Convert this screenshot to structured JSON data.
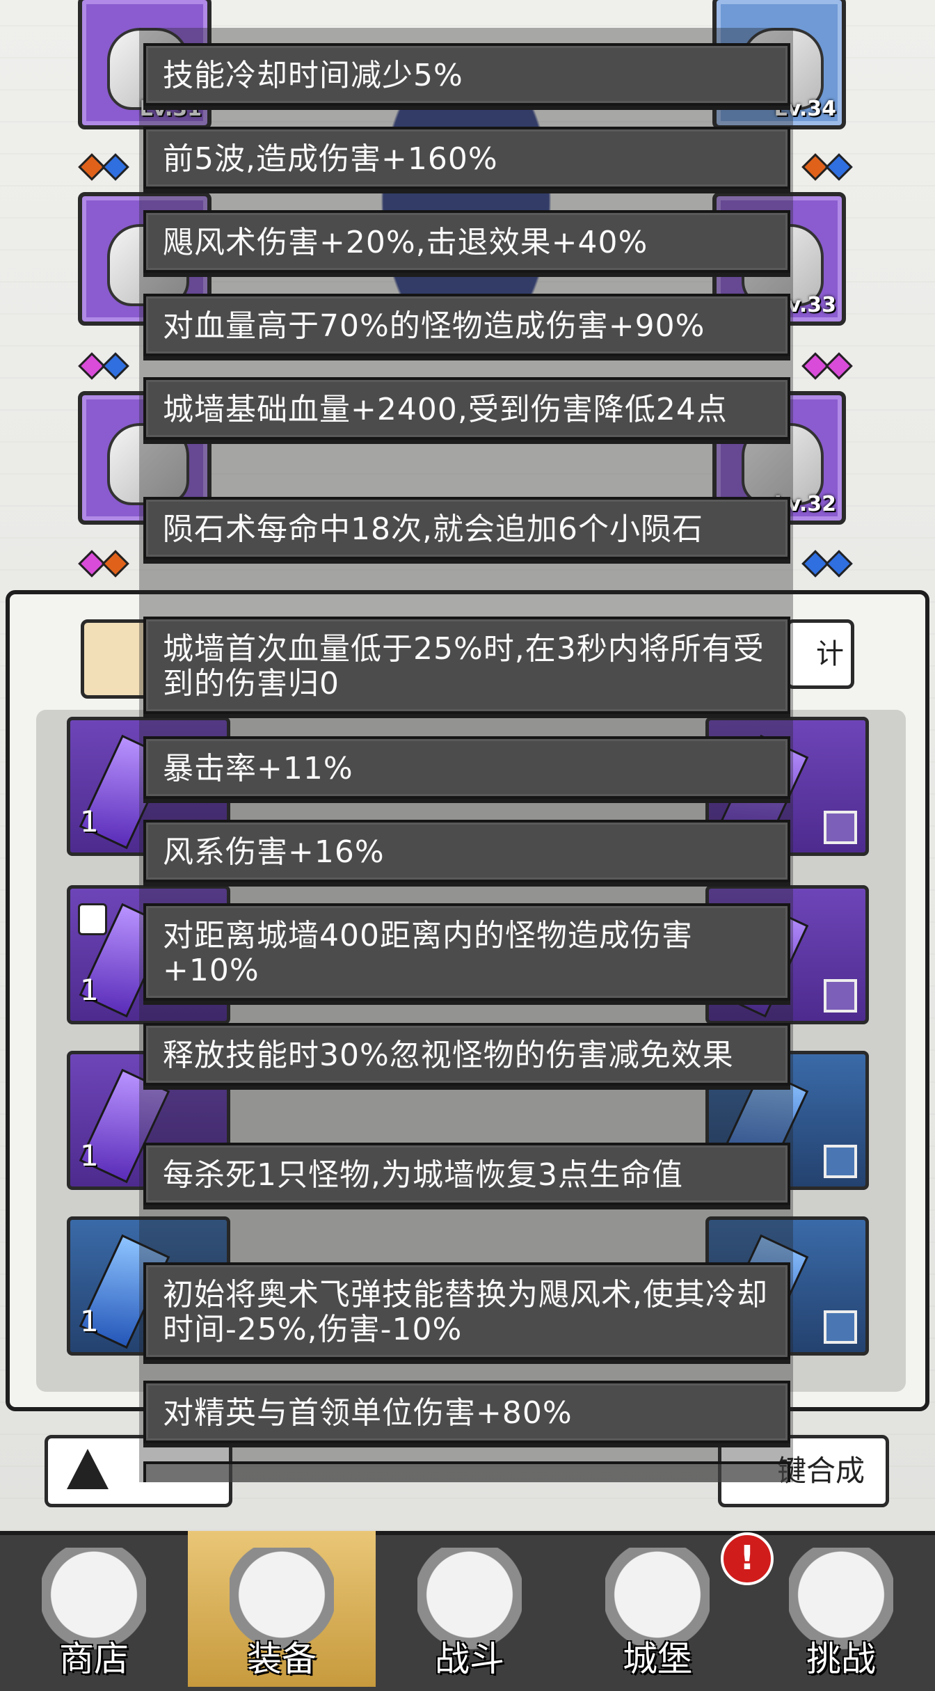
{
  "hero_slots": [
    {
      "level": "Lv.31",
      "gems": [
        "orange",
        "blue"
      ]
    },
    {
      "level": "Lv.34",
      "gems": [
        "orange",
        "blue"
      ]
    },
    {
      "level": "",
      "gems": [
        "pink",
        "blue"
      ]
    },
    {
      "level": "Lv.33",
      "gems": [
        "pink",
        "pink"
      ]
    },
    {
      "level": "",
      "gems": [
        "pink",
        "orange"
      ]
    },
    {
      "level": "Lv.32",
      "gems": [
        "blue",
        "blue"
      ]
    }
  ],
  "panel": {
    "stats_button_label": "计"
  },
  "cards": [
    {
      "qty": "1"
    },
    {
      "qty": "1"
    },
    {
      "qty": "1"
    },
    {
      "qty": "1"
    }
  ],
  "bottom": {
    "left_button_label": "",
    "right_button_label": "键合成"
  },
  "entries": [
    "技能冷却时间减少5%",
    "前5波,造成伤害+160%",
    "飓风术伤害+20%,击退效果+40%",
    "对血量高于70%的怪物造成伤害+90%",
    "城墙基础血量+2400,受到伤害降低24点",
    "陨石术每命中18次,就会追加6个小陨石",
    "城墙首次血量低于25%时,在3秒内将所有受到的伤害归0",
    "暴击率+11%",
    "风系伤害+16%",
    "对距离城墙400距离内的怪物造成伤害+10%",
    "释放技能时30%忽视怪物的伤害减免效果",
    "每杀死1只怪物,为城墙恢复3点生命值",
    "初始将奥术飞弹技能替换为飓风术,使其冷却时间-25%,伤害-10%",
    "对精英与首领单位伤害+80%"
  ],
  "partial_entry": "",
  "nav": [
    {
      "label": "商店",
      "icon": "shop-icon"
    },
    {
      "label": "装备",
      "icon": "backpack-icon",
      "active": true
    },
    {
      "label": "战斗",
      "icon": "crossed-swords-icon"
    },
    {
      "label": "城堡",
      "icon": "castle-icon",
      "alert": "!"
    },
    {
      "label": "挑战",
      "icon": "shield-icon"
    }
  ],
  "colors": {
    "entry_bg": "#4c4c4c",
    "rare_purple": "#8a5ccf",
    "rare_blue": "#6f9ad6",
    "nav_active": "#e9c677",
    "alert_red": "#d11c1c"
  }
}
